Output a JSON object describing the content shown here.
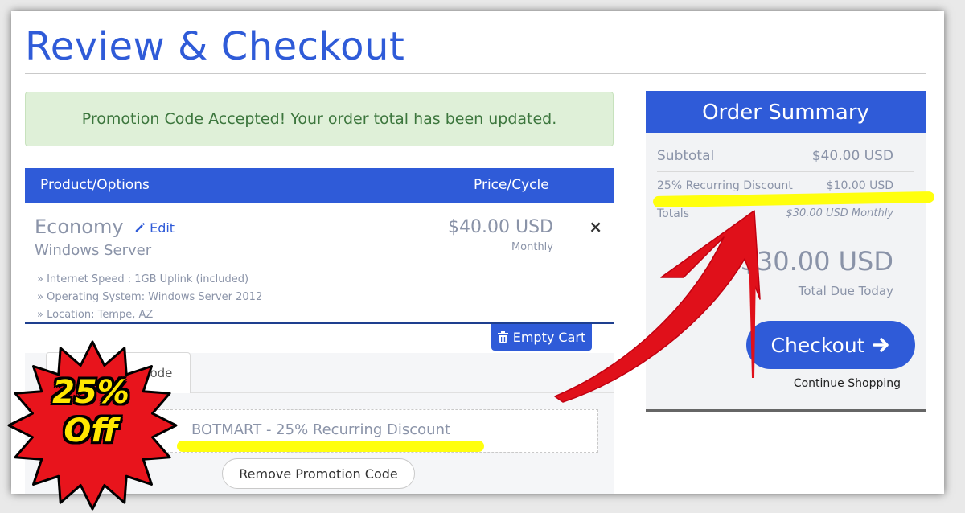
{
  "page": {
    "title": "Review & Checkout",
    "alert": "Promotion Code Accepted! Your order total has been updated."
  },
  "cart": {
    "header": {
      "product_col": "Product/Options",
      "price_col": "Price/Cycle"
    },
    "item": {
      "name": "Economy",
      "edit_label": "Edit",
      "group": "Windows Server",
      "options": [
        "» Internet Speed : 1GB Uplink (included)",
        "» Operating System: Windows Server 2012",
        "» Location: Tempe, AZ"
      ],
      "price": "$40.00 USD",
      "cycle": "Monthly",
      "remove_symbol": "×"
    },
    "empty_cart_label": "Empty Cart"
  },
  "promo": {
    "tab_label": "Code",
    "applied_text": "BOTMART - 25% Recurring Discount",
    "remove_button": "Remove Promotion Code"
  },
  "summary": {
    "title": "Order Summary",
    "subtotal_label": "Subtotal",
    "subtotal_value": "$40.00 USD",
    "discount_label": "25% Recurring Discount",
    "discount_value": "$10.00 USD",
    "totals_label": "Totals",
    "totals_value": "$30.00 USD Monthly",
    "total_amount": "$30.00 USD",
    "total_due_label": "Total Due Today",
    "checkout_label": "Checkout",
    "continue_label": "Continue Shopping"
  },
  "badge": {
    "line1": "25%",
    "line2": "Off"
  },
  "colors": {
    "primary": "#2f5bd8",
    "alert_bg": "#dff0d8",
    "alert_text": "#3c763d",
    "highlight": "#ffff00",
    "arrow": "#e0101a",
    "badge_fill": "#e8141c",
    "badge_text": "#ffe600"
  }
}
